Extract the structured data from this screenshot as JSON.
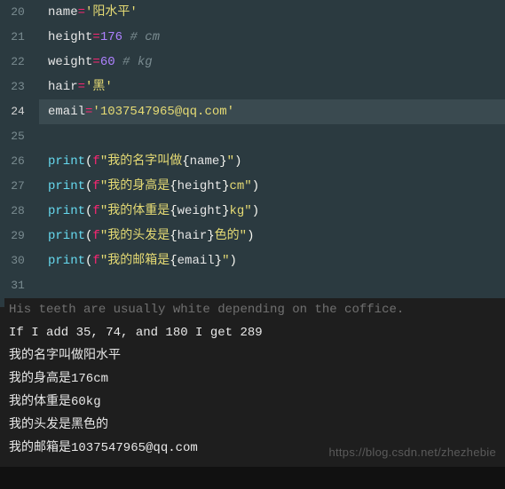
{
  "editor": {
    "lines": [
      {
        "no": 20,
        "ident": "name",
        "op": "=",
        "str": "'阳水平'",
        "cmt": ""
      },
      {
        "no": 21,
        "ident": "height",
        "op": "=",
        "num": "176",
        "cmt": " # cm"
      },
      {
        "no": 22,
        "ident": "weight",
        "op": "=",
        "num": "60",
        "cmt": " # kg"
      },
      {
        "no": 23,
        "ident": "hair",
        "op": "=",
        "str": "'黑'",
        "cmt": ""
      },
      {
        "no": 24,
        "ident": "email",
        "op": "=",
        "str": "'1037547965@qq.com'",
        "cmt": "",
        "current": true
      },
      {
        "no": 25,
        "blank": true
      },
      {
        "no": 26,
        "print": true,
        "s1": "\"我的名字叫做",
        "var": "name",
        "s2": "\""
      },
      {
        "no": 27,
        "print": true,
        "s1": "\"我的身高是",
        "var": "height",
        "s2": "cm\""
      },
      {
        "no": 28,
        "print": true,
        "s1": "\"我的体重是",
        "var": "weight",
        "s2": "kg\""
      },
      {
        "no": 29,
        "print": true,
        "s1": "\"我的头发是",
        "var": "hair",
        "s2": "色的\""
      },
      {
        "no": 30,
        "print": true,
        "s1": "\"我的邮箱是",
        "var": "email",
        "s2": "\""
      },
      {
        "no": 31,
        "blank": true
      }
    ]
  },
  "console": {
    "lines": [
      "His teeth are usually white depending on the coffice.",
      "If I add 35, 74, and 180 I get 289",
      "我的名字叫做阳水平",
      "我的身高是176cm",
      "我的体重是60kg",
      "我的头发是黑色的",
      "我的邮箱是1037547965@qq.com"
    ]
  },
  "watermark": "https://blog.csdn.net/zhezhebie",
  "code_values": {
    "name": "阳水平",
    "height": 176,
    "height_unit": "cm",
    "weight": 60,
    "weight_unit": "kg",
    "hair": "黑",
    "email": "1037547965@qq.com"
  }
}
